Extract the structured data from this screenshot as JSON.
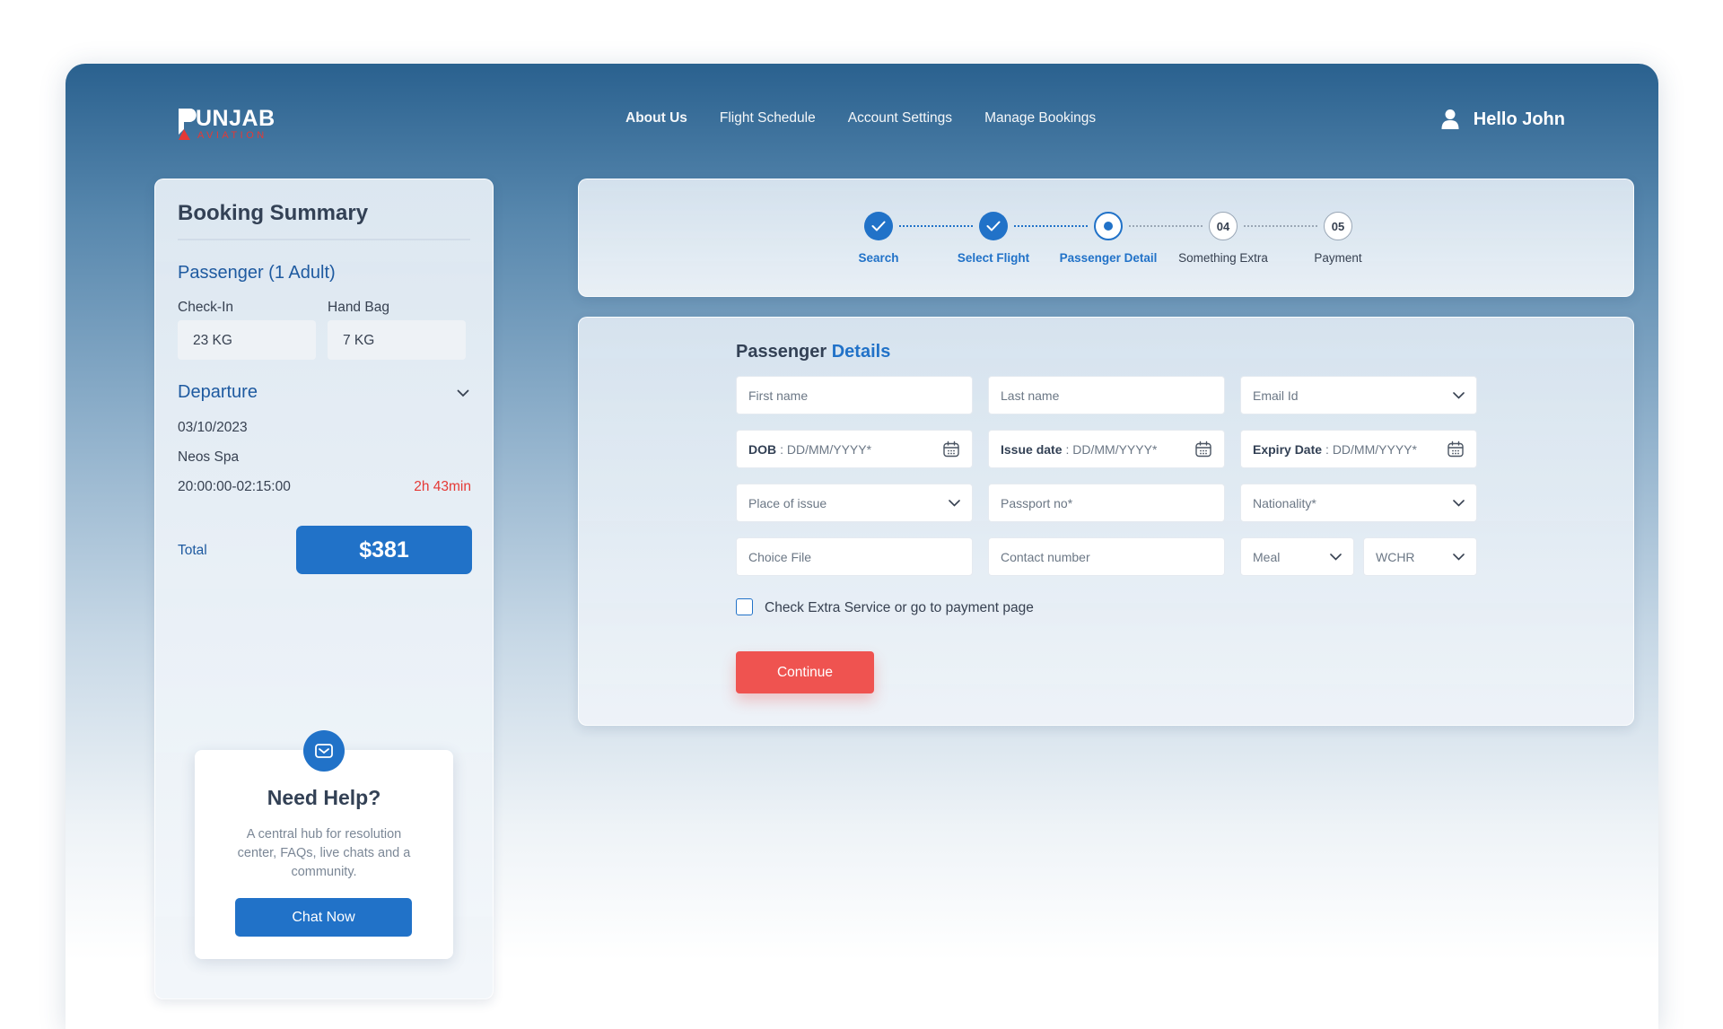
{
  "brand": {
    "word": "UNJAB",
    "sub": "AVIATION"
  },
  "nav": [
    {
      "label": "About Us",
      "active": true
    },
    {
      "label": "Flight Schedule",
      "active": false
    },
    {
      "label": "Account Settings",
      "active": false
    },
    {
      "label": "Manage Bookings",
      "active": false
    }
  ],
  "user": {
    "greeting": "Hello John",
    "icon": "user-icon"
  },
  "summary": {
    "title": "Booking Summary",
    "passenger_title": "Passenger (1 Adult)",
    "checkin_label": "Check-In",
    "checkin_value": "23 KG",
    "handbag_label": "Hand Bag",
    "handbag_value": "7 KG",
    "departure_title": "Departure",
    "date": "03/10/2023",
    "carrier": "Neos Spa",
    "time": "20:00:00-02:15:00",
    "duration": "2h 43min",
    "total_label": "Total",
    "total_value": "$381"
  },
  "help": {
    "title": "Need Help?",
    "text": "A central hub for resolution center, FAQs, live chats and a community.",
    "button": "Chat Now",
    "icon": "mail-icon"
  },
  "steps": [
    {
      "label": "Search",
      "state": "done",
      "number": ""
    },
    {
      "label": "Select Flight",
      "state": "done",
      "number": ""
    },
    {
      "label": "Passenger Detail",
      "state": "current",
      "number": ""
    },
    {
      "label": "Something Extra",
      "state": "todo",
      "number": "04"
    },
    {
      "label": "Payment",
      "state": "todo",
      "number": "05"
    }
  ],
  "form": {
    "title_plain": "Passenger",
    "title_accent": "Details",
    "first_name": "First name",
    "last_name": "Last name",
    "email": "Email Id",
    "dob_label": "DOB",
    "dob_placeholder": ": DD/MM/YYYY*",
    "issue_label": "Issue date",
    "issue_placeholder": ": DD/MM/YYYY*",
    "expiry_label": "Expiry Date",
    "expiry_placeholder": ": DD/MM/YYYY*",
    "place_of_issue": "Place of issue",
    "passport": "Passport no*",
    "nationality": "Nationality*",
    "choice_file": "Choice File",
    "contact": "Contact number",
    "meal": "Meal",
    "wchr": "WCHR",
    "checkbox_label": "Check Extra Service or go to payment page",
    "continue": "Continue"
  },
  "colors": {
    "primary": "#2172c8",
    "accent_red": "#ef5350",
    "header_blue": "#2a618f"
  }
}
